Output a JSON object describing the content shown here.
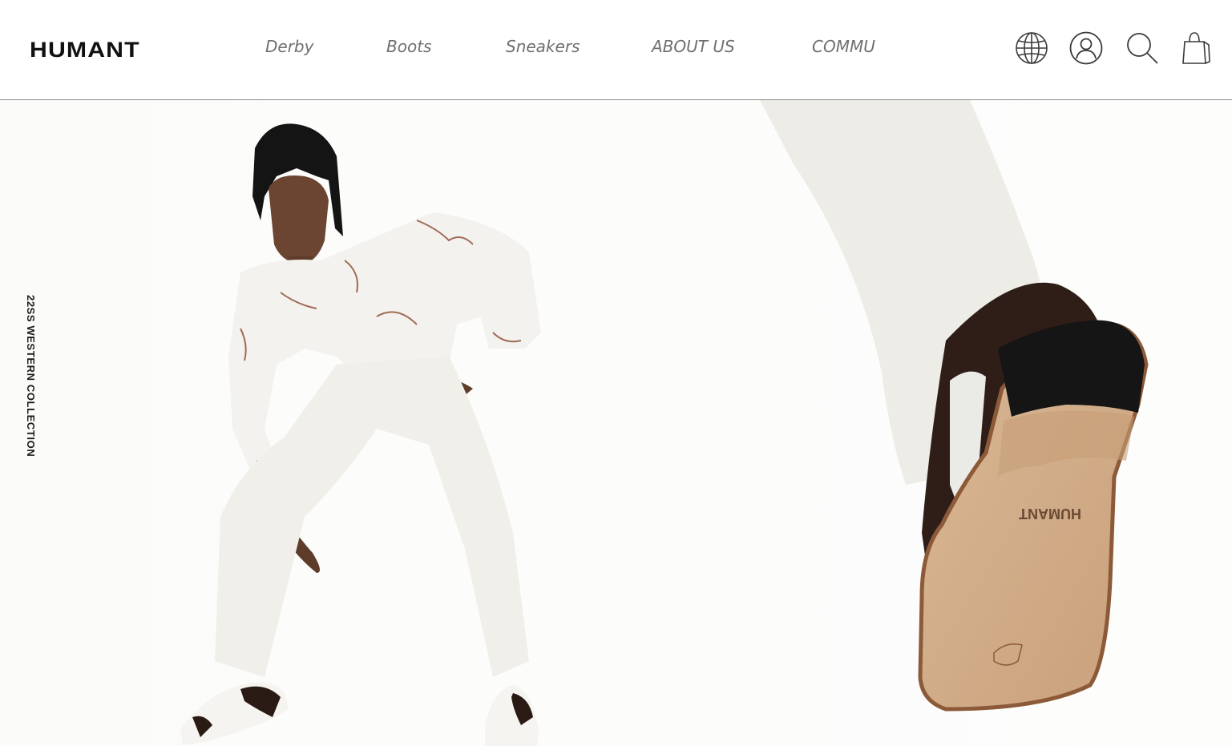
{
  "brand": {
    "logo_text": "HUMANT"
  },
  "nav": {
    "items": [
      {
        "label": "Derby"
      },
      {
        "label": "Boots"
      },
      {
        "label": "Sneakers"
      },
      {
        "label": "ABOUT US"
      },
      {
        "label": "COMMU"
      }
    ]
  },
  "header_icons": {
    "globe": "globe-icon",
    "account": "user-icon",
    "search": "search-icon",
    "cart": "shopping-bag-icon"
  },
  "hero": {
    "side_label": "22SS WESTERN COLLECTION",
    "sole_brand_text": "HUMANT"
  },
  "colors": {
    "text_primary": "#111111",
    "nav_text": "#6f6f6f",
    "divider": "#8a8a8a",
    "background": "#ffffff"
  }
}
